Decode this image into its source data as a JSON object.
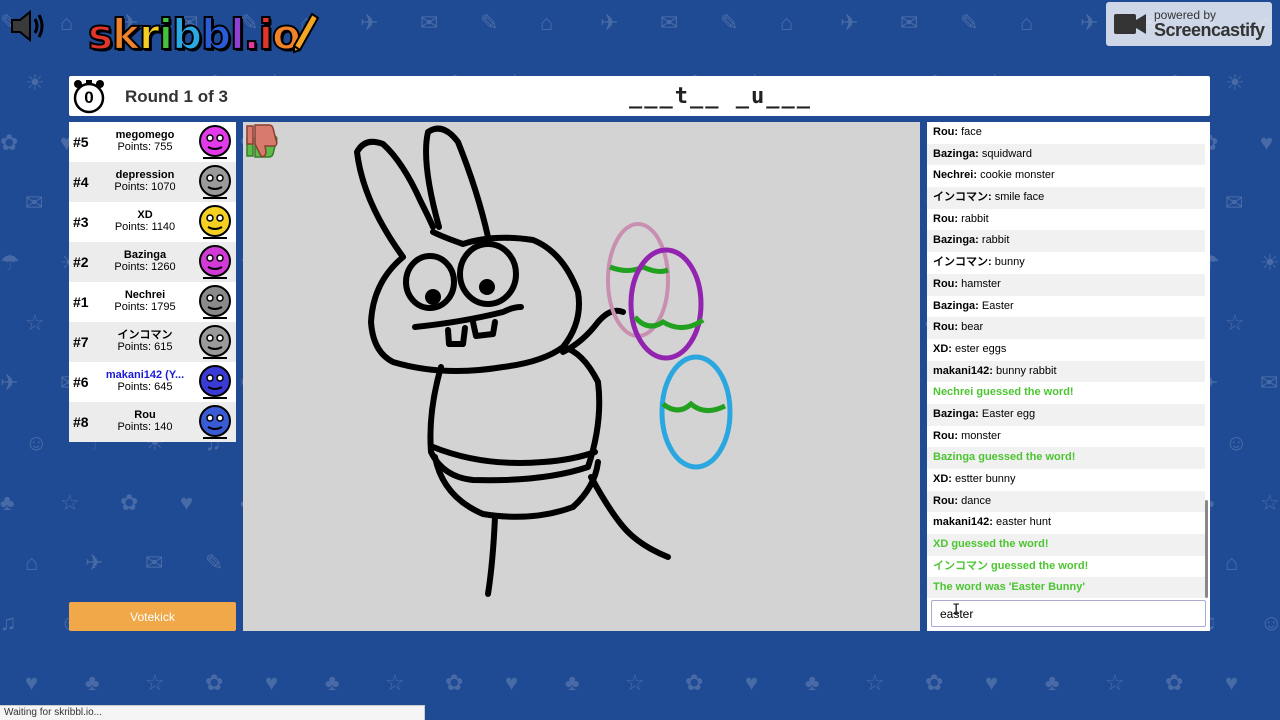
{
  "app": {
    "logo_text": "skribbl.io",
    "logo_letters": [
      {
        "ch": "s",
        "color": "#e2352b"
      },
      {
        "ch": "k",
        "color": "#f0832a"
      },
      {
        "ch": "r",
        "color": "#f5d023"
      },
      {
        "ch": "i",
        "color": "#45c33c"
      },
      {
        "ch": "b",
        "color": "#2ba7e1"
      },
      {
        "ch": "b",
        "color": "#2a5bd6"
      },
      {
        "ch": "l",
        "color": "#8f3fd1"
      },
      {
        "ch": ".",
        "color": "#e23aa0"
      },
      {
        "ch": "i",
        "color": "#e2352b"
      },
      {
        "ch": "o",
        "color": "#f0832a"
      }
    ]
  },
  "watermark": {
    "small": "powered by",
    "big": "Screencastify"
  },
  "header": {
    "timer": "0",
    "round": "Round 1 of 3",
    "word_hint": "___t__ _u___"
  },
  "players": [
    {
      "rank": "#5",
      "name": "megomego",
      "points": "Points: 755",
      "color": "#e23aeb",
      "self": false
    },
    {
      "rank": "#4",
      "name": "depression",
      "points": "Points: 1070",
      "color": "#9a9a9a",
      "self": false
    },
    {
      "rank": "#3",
      "name": "XD",
      "points": "Points: 1140",
      "color": "#f5d023",
      "self": false
    },
    {
      "rank": "#2",
      "name": "Bazinga",
      "points": "Points: 1260",
      "color": "#d13ad6",
      "self": false
    },
    {
      "rank": "#1",
      "name": "Nechrei",
      "points": "Points: 1795",
      "color": "#8a8a8a",
      "self": false
    },
    {
      "rank": "#7",
      "name": "インコマン",
      "points": "Points: 615",
      "color": "#9a9a9a",
      "self": false
    },
    {
      "rank": "#6",
      "name": "makani142 (Y...",
      "points": "Points: 645",
      "color": "#3a3ad6",
      "self": true
    },
    {
      "rank": "#8",
      "name": "Rou",
      "points": "Points: 140",
      "color": "#3a5bd6",
      "self": false
    }
  ],
  "votekick_label": "Votekick",
  "chat": {
    "messages": [
      {
        "who": "Rou:",
        "text": " face",
        "type": "chat"
      },
      {
        "who": "Bazinga:",
        "text": " squidward",
        "type": "chat"
      },
      {
        "who": "Nechrei:",
        "text": " cookie monster",
        "type": "chat"
      },
      {
        "who": "インコマン:",
        "text": " smile face",
        "type": "chat"
      },
      {
        "who": "Rou:",
        "text": " rabbit",
        "type": "chat"
      },
      {
        "who": "Bazinga:",
        "text": " rabbit",
        "type": "chat"
      },
      {
        "who": "インコマン:",
        "text": " bunny",
        "type": "chat"
      },
      {
        "who": "Rou:",
        "text": " hamster",
        "type": "chat"
      },
      {
        "who": "Bazinga:",
        "text": " Easter",
        "type": "chat"
      },
      {
        "who": "Rou:",
        "text": " bear",
        "type": "chat"
      },
      {
        "who": "XD:",
        "text": " ester eggs",
        "type": "chat"
      },
      {
        "who": "makani142:",
        "text": " bunny rabbit",
        "type": "chat"
      },
      {
        "who": "",
        "text": "Nechrei guessed the word!",
        "type": "guess"
      },
      {
        "who": "Bazinga:",
        "text": " Easter egg",
        "type": "chat"
      },
      {
        "who": "Rou:",
        "text": " monster",
        "type": "chat"
      },
      {
        "who": "",
        "text": "Bazinga guessed the word!",
        "type": "guess"
      },
      {
        "who": "XD:",
        "text": " estter bunny",
        "type": "chat"
      },
      {
        "who": "Rou:",
        "text": " dance",
        "type": "chat"
      },
      {
        "who": "makani142:",
        "text": " easter hunt",
        "type": "chat"
      },
      {
        "who": "",
        "text": "XD guessed the word!",
        "type": "guess"
      },
      {
        "who": "",
        "text": "インコマン guessed the word!",
        "type": "guess"
      },
      {
        "who": "",
        "text": "The word was 'Easter Bunny'",
        "type": "guess"
      }
    ],
    "input_value": "easter"
  },
  "status_bar": "Waiting for skribbl.io..."
}
